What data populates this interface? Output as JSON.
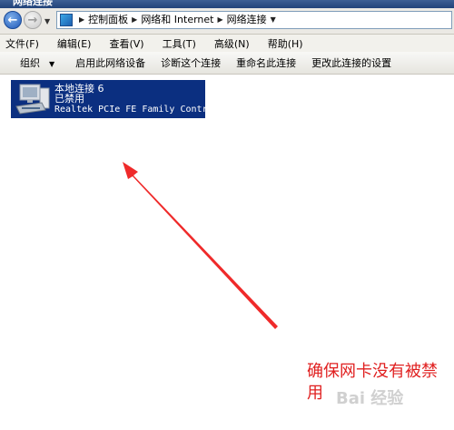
{
  "window": {
    "title": "网络连接"
  },
  "address": {
    "crumbs": [
      "控制面板",
      "网络和 Internet",
      "网络连接"
    ]
  },
  "menu": [
    "文件(F)",
    "编辑(E)",
    "查看(V)",
    "工具(T)",
    "高级(N)",
    "帮助(H)"
  ],
  "commands": {
    "organize": "组织",
    "enable": "启用此网络设备",
    "diagnose": "诊断这个连接",
    "rename": "重命名此连接",
    "settings": "更改此连接的设置"
  },
  "connection": {
    "name": "本地连接 6",
    "status": "已禁用",
    "device": "Realtek PCIe FE Family Contr..."
  },
  "annotation": {
    "text": "确保网卡没有被禁用",
    "color": "#e02020"
  },
  "watermark": "Bai 经验"
}
